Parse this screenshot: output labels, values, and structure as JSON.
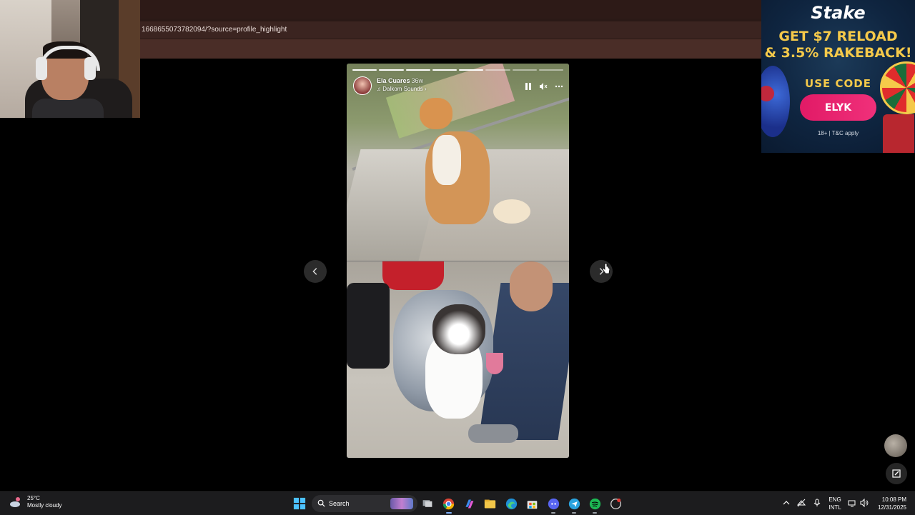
{
  "browser": {
    "url_fragment": "1668655073782094/?source=profile_highlight"
  },
  "ad": {
    "brand": "Stake",
    "headline_line1": "GET $7 RELOAD",
    "headline_line2": "& 3.5% RAKEBACK!",
    "use_code": "USE CODE",
    "code": "ELYK",
    "terms": "18+ | T&C apply",
    "colors": {
      "headline": "#f5c94a",
      "button": "#e11a66",
      "background": "#0f2540"
    }
  },
  "story": {
    "username": "Ela Cuares",
    "time_ago": "36w",
    "music": "Dalkom Sounds",
    "progress_segments": 8,
    "progress_done": 5,
    "controls": [
      "pause-icon",
      "mute-icon",
      "more-icon"
    ]
  },
  "nav": {
    "prev_icon": "chevron-left-icon",
    "next_icon": "chevron-right-icon"
  },
  "taskbar": {
    "weather_temp": "25°C",
    "weather_desc": "Mostly cloudy",
    "search_label": "Search",
    "lang_line1": "ENG",
    "lang_line2": "INTL",
    "time": "10:08 PM",
    "date": "12/31/2025",
    "apps": [
      "windows-start-icon",
      "task-view-icon",
      "chrome-icon",
      "copilot-icon",
      "file-explorer-icon",
      "edge-icon",
      "store-icon",
      "discord-icon",
      "telegram-icon",
      "spotify-icon",
      "app-icon"
    ]
  }
}
